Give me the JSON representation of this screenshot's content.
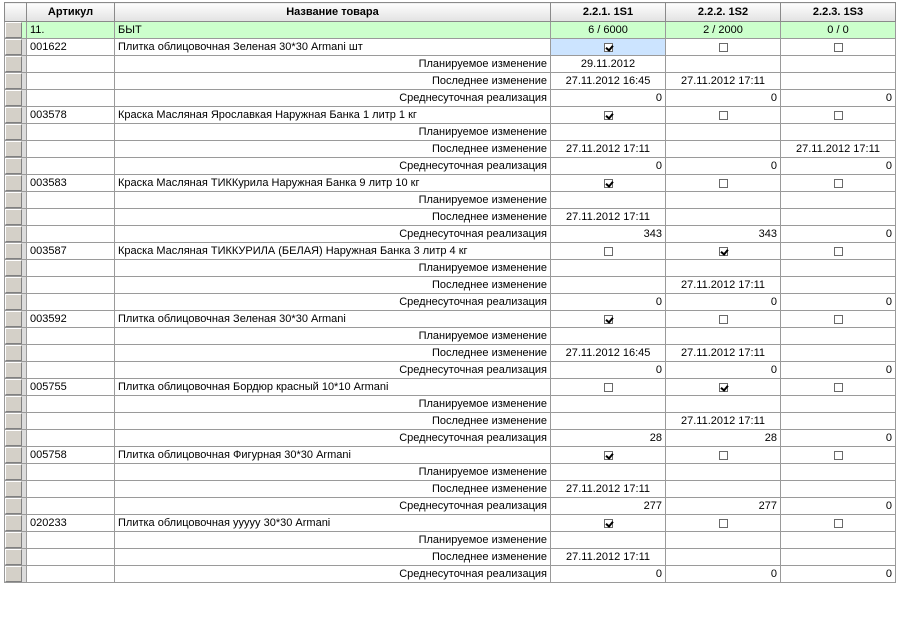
{
  "columns": [
    "Артикул",
    "Название товара",
    "2.2.1. 1S1",
    "2.2.2. 1S2",
    "2.2.3. 1S3"
  ],
  "group": {
    "code": "11.",
    "name": "БЫТ",
    "s1": "6 / 6000",
    "s2": "2 / 2000",
    "s3": "0 / 0"
  },
  "labels": {
    "planned": "Планируемое изменение",
    "last": "Последнее изменение",
    "avg": "Среднесуточная реализация"
  },
  "products": [
    {
      "code": "001622",
      "name": "Плитка облицовочная Зеленая 30*30 Armani шт",
      "checks": [
        true,
        false,
        false
      ],
      "planned": [
        "29.11.2012",
        "",
        ""
      ],
      "last": [
        "27.11.2012 16:45",
        "27.11.2012 17:11",
        ""
      ],
      "avg": [
        "0",
        "0",
        "0"
      ]
    },
    {
      "code": "003578",
      "name": "Краска Масляная Ярославкая Наружная Банка 1 литр 1 кг",
      "checks": [
        true,
        false,
        false
      ],
      "planned": [
        "",
        "",
        ""
      ],
      "last": [
        "27.11.2012 17:11",
        "",
        "27.11.2012 17:11"
      ],
      "avg": [
        "0",
        "0",
        "0"
      ]
    },
    {
      "code": "003583",
      "name": "Краска Масляная ТИККурила Наружная Банка 9 литр 10 кг",
      "checks": [
        true,
        false,
        false
      ],
      "planned": [
        "",
        "",
        ""
      ],
      "last": [
        "27.11.2012 17:11",
        "",
        ""
      ],
      "avg": [
        "343",
        "343",
        "0"
      ]
    },
    {
      "code": "003587",
      "name": "Краска Масляная ТИККУРИЛА (БЕЛАЯ) Наружная Банка 3 литр 4 кг",
      "checks": [
        false,
        true,
        false
      ],
      "planned": [
        "",
        "",
        ""
      ],
      "last": [
        "",
        "27.11.2012 17:11",
        ""
      ],
      "avg": [
        "0",
        "0",
        "0"
      ]
    },
    {
      "code": "003592",
      "name": "Плитка облицовочная Зеленая 30*30 Armani",
      "checks": [
        true,
        false,
        false
      ],
      "planned": [
        "",
        "",
        ""
      ],
      "last": [
        "27.11.2012 16:45",
        "27.11.2012 17:11",
        ""
      ],
      "avg": [
        "0",
        "0",
        "0"
      ]
    },
    {
      "code": "005755",
      "name": "Плитка облицовочная Бордюр красный 10*10 Armani",
      "checks": [
        false,
        true,
        false
      ],
      "planned": [
        "",
        "",
        ""
      ],
      "last": [
        "",
        "27.11.2012 17:11",
        ""
      ],
      "avg": [
        "28",
        "28",
        "0"
      ]
    },
    {
      "code": "005758",
      "name": "Плитка облицовочная Фигурная 30*30 Armani",
      "checks": [
        true,
        false,
        false
      ],
      "planned": [
        "",
        "",
        ""
      ],
      "last": [
        "27.11.2012 17:11",
        "",
        ""
      ],
      "avg": [
        "277",
        "277",
        "0"
      ]
    },
    {
      "code": "020233",
      "name": "Плитка облицовочная ууууу 30*30 Armani",
      "checks": [
        true,
        false,
        false
      ],
      "planned": [
        "",
        "",
        ""
      ],
      "last": [
        "27.11.2012 17:11",
        "",
        ""
      ],
      "avg": [
        "0",
        "0",
        "0"
      ]
    }
  ]
}
